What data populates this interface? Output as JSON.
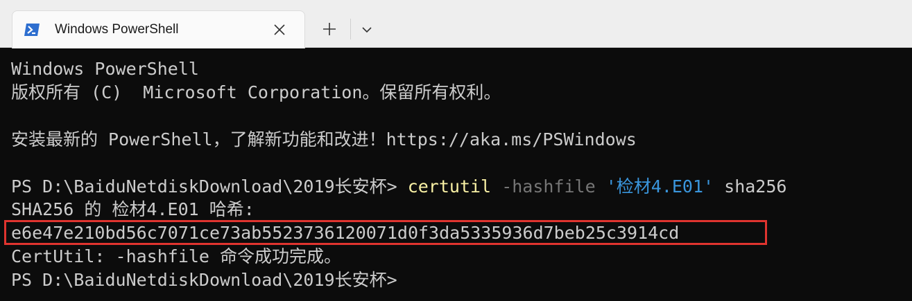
{
  "tab": {
    "title": "Windows PowerShell",
    "icon": "powershell-icon"
  },
  "tabbar": {
    "new_tab_icon": "plus-icon",
    "dropdown_icon": "chevron-down-icon",
    "close_icon": "close-icon"
  },
  "terminal": {
    "banner_title": "Windows PowerShell",
    "copyright": "版权所有 (C)  Microsoft Corporation。保留所有权利。",
    "update_notice": "安装最新的 PowerShell，了解新功能和改进！https://aka.ms/PSWindows",
    "prompt": "PS D:\\BaiduNetdiskDownload\\2019长安杯> ",
    "command": {
      "name": "certutil",
      "param": "-hashfile",
      "file": "'检材4.E01'",
      "algorithm": "sha256"
    },
    "hash_header": "SHA256 的 检材4.E01 哈希:",
    "hash_value": "e6e47e210bd56c7071ce73ab5523736120071d0f3da5335936d7beb25c3914cd",
    "success_message": "CertUtil: -hashfile 命令成功完成。",
    "final_prompt": "PS D:\\BaiduNetdiskDownload\\2019长安杯>"
  },
  "colors": {
    "background": "#0c0c0c",
    "text": "#cccccc",
    "command": "#f9f1a5",
    "parameter": "#767676",
    "string": "#3a96dd",
    "highlight_box": "#e0342f"
  }
}
